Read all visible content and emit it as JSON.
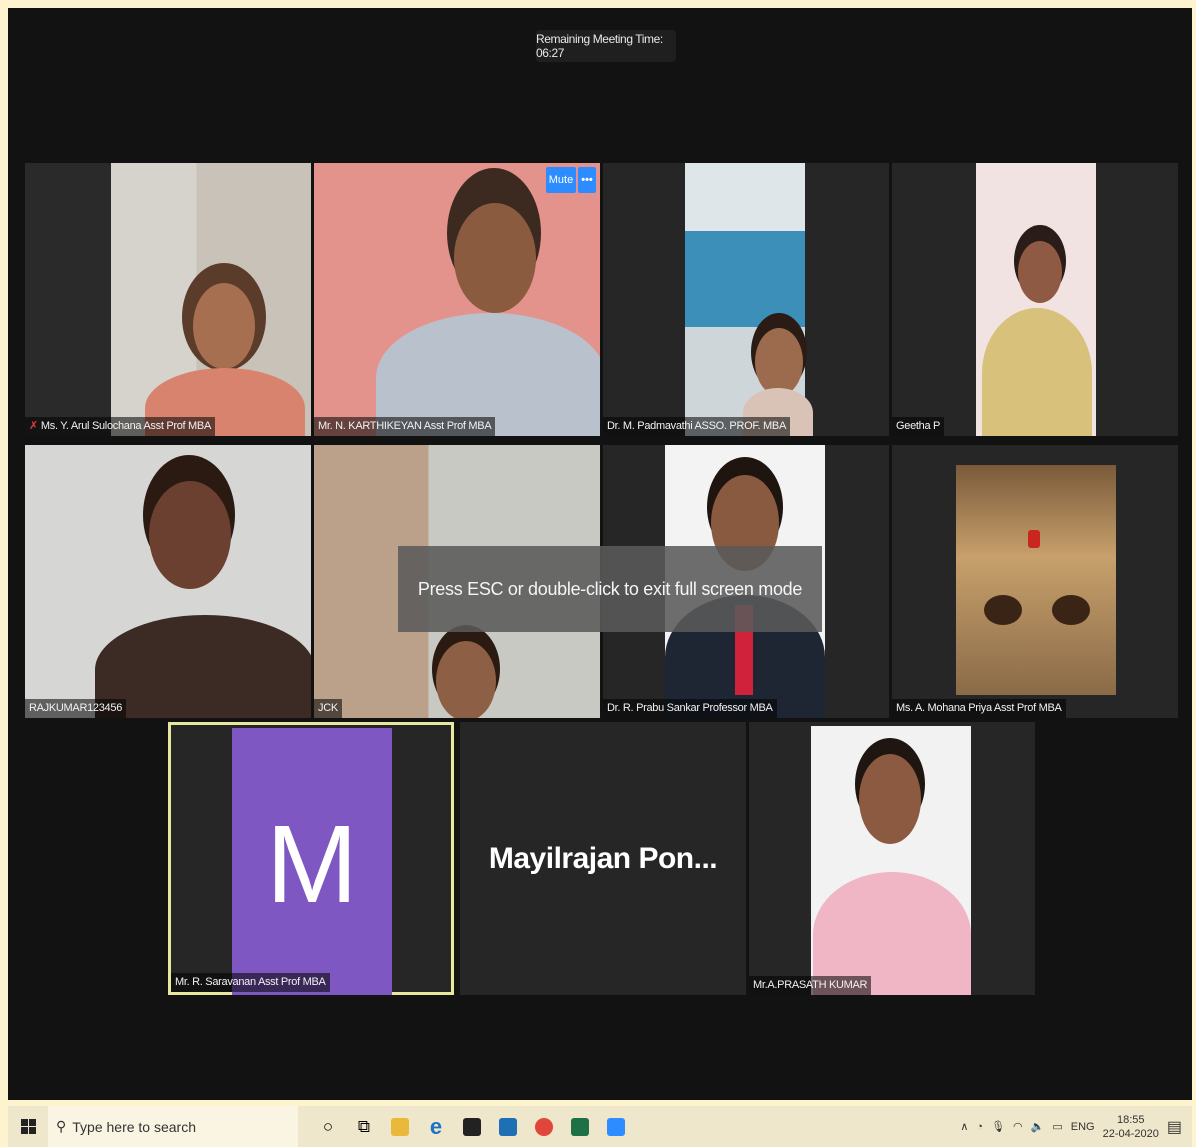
{
  "meeting": {
    "remaining_time": "Remaining Meeting Time: 06:27",
    "fullscreen_toast": "Press ESC or double-click to exit full screen mode",
    "mute_label": "Mute",
    "more_label": "•••"
  },
  "participants": [
    {
      "name": "Ms. Y. Arul Sulochana Asst Prof MBA",
      "muted": true
    },
    {
      "name": "Mr. N. KARTHIKEYAN Asst Prof MBA"
    },
    {
      "name": "Dr. M. Padmavathi ASSO. PROF. MBA"
    },
    {
      "name": "Geetha P"
    },
    {
      "name": "RAJKUMAR123456"
    },
    {
      "name": "JCK"
    },
    {
      "name": "Dr. R. Prabu Sankar Professor MBA"
    },
    {
      "name": "Ms. A. Mohana Priya Asst Prof MBA"
    },
    {
      "name": "Mr. R. Saravanan Asst Prof MBA",
      "avatar_letter": "M",
      "active_speaker": true
    },
    {
      "name": "Mayilrajan  Pon..."
    },
    {
      "name": "Mr.A.PRASATH KUMAR"
    }
  ],
  "taskbar": {
    "search_placeholder": "Type here to search",
    "language": "ENG",
    "time": "18:55",
    "date": "22-04-2020"
  },
  "colors": {
    "page_border": "#fdf3cf",
    "meeting_bg": "#121212",
    "tile_bg": "#262626",
    "zoom_blue": "#2d8cff",
    "avatar_purple": "#7e57c2",
    "active_outline": "#e7e7a0"
  }
}
